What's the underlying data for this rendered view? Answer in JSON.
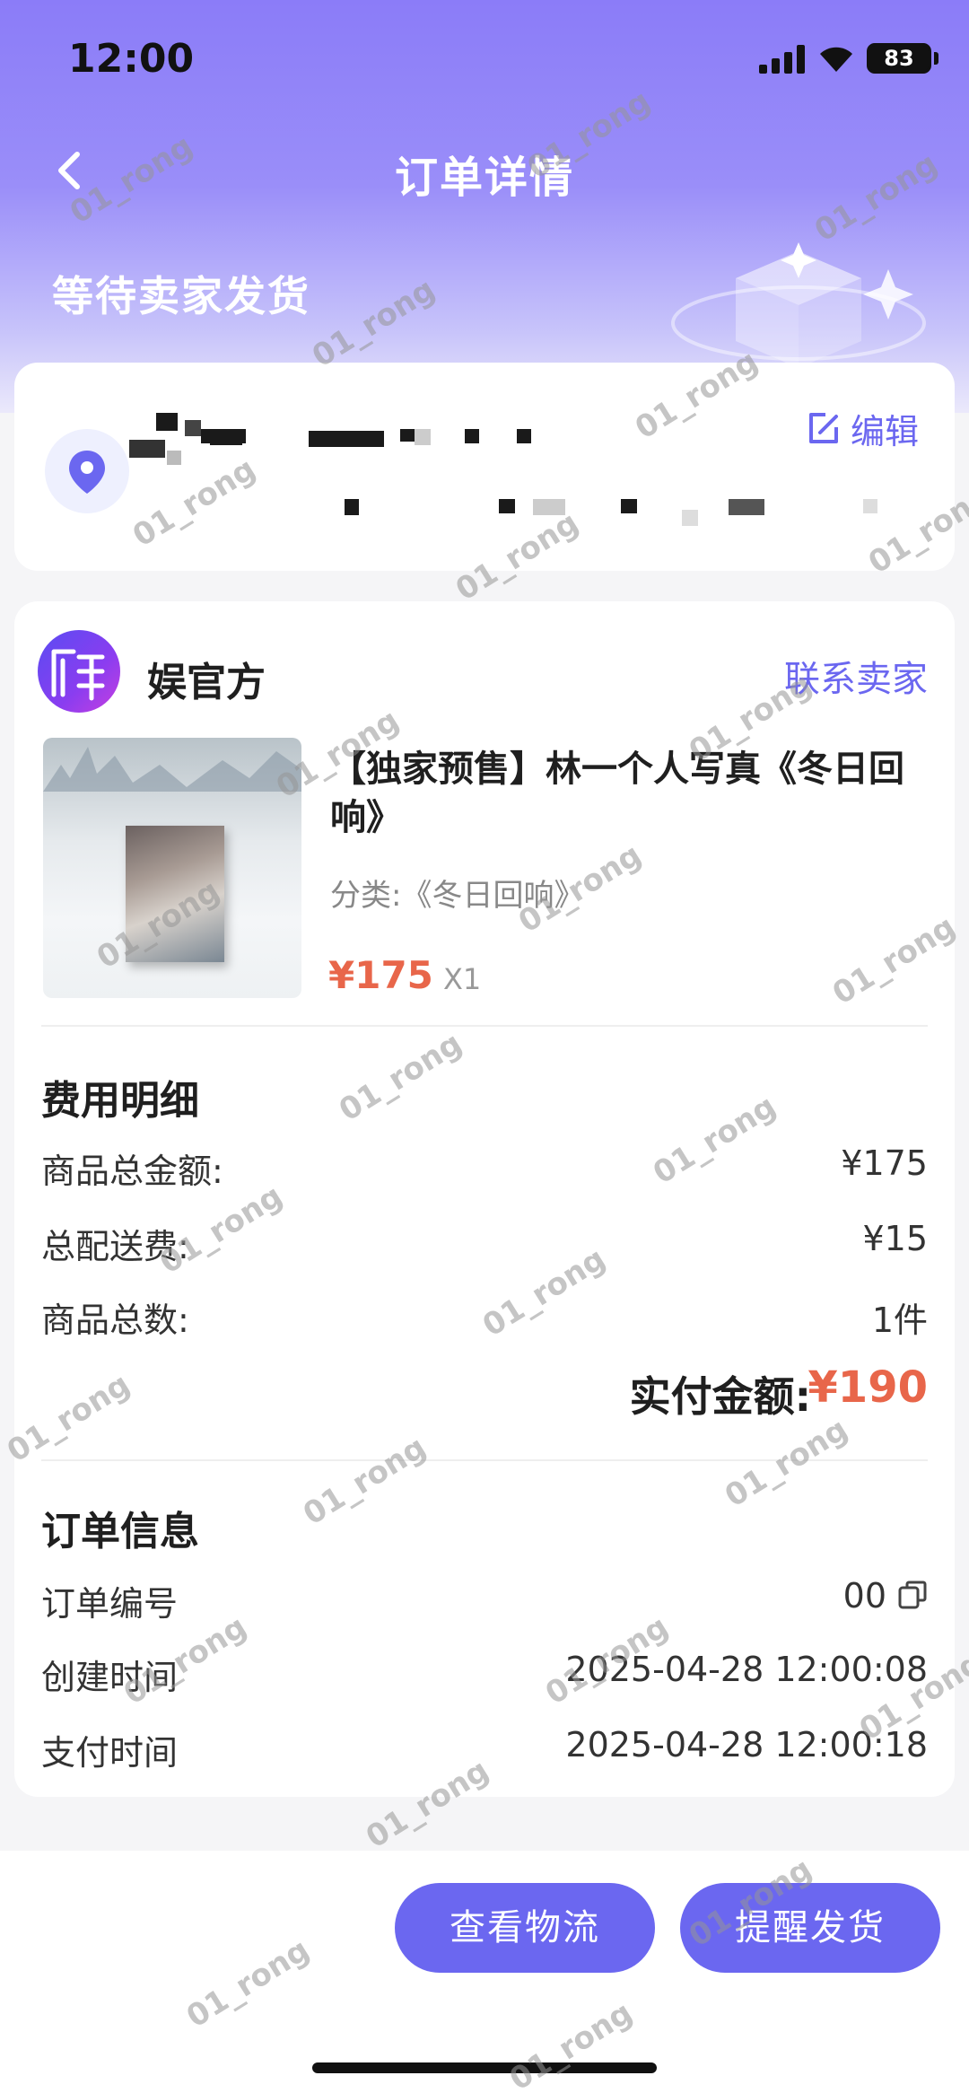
{
  "status_bar": {
    "time": "12:00",
    "battery": "83"
  },
  "nav": {
    "title": "订单详情",
    "back_icon": "chevron-left-icon"
  },
  "order_status": "等待卖家发货",
  "address": {
    "edit_label": "编辑"
  },
  "shop": {
    "name": "娱官方",
    "contact_label": "联系卖家"
  },
  "product": {
    "title": "【独家预售】林一个人写真《冬日回响》",
    "category": "分类:《冬日回响》",
    "price": "¥175",
    "quantity": "X1"
  },
  "fees": {
    "title": "费用明细",
    "rows": [
      {
        "label": "商品总金额:",
        "value": "¥175"
      },
      {
        "label": "总配送费:",
        "value": "¥15"
      },
      {
        "label": "商品总数:",
        "value": "1件"
      }
    ],
    "total_label": "实付金额:",
    "total_value": "¥190"
  },
  "order_info": {
    "title": "订单信息",
    "rows": [
      {
        "label": "订单编号",
        "value": "00"
      },
      {
        "label": "创建时间",
        "value": "2025-04-28 12:00:08"
      },
      {
        "label": "支付时间",
        "value": "2025-04-28 12:00:18"
      }
    ]
  },
  "actions": {
    "logistics_label": "查看物流",
    "remind_label": "提醒发货"
  },
  "watermark_text": "01_rong",
  "colors": {
    "accent": "#6b67f0",
    "price": "#e8664a",
    "header": "#8b7cf8"
  }
}
